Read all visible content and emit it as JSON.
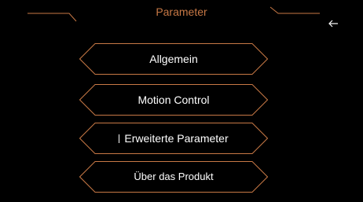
{
  "header": {
    "title": "Parameter",
    "back_icon": "left-arrow-icon",
    "accent_color": "#c77845"
  },
  "menu": {
    "items": [
      {
        "label": "Allgemein"
      },
      {
        "label": "Motion Control"
      },
      {
        "label": "Erweiterte Parameter"
      },
      {
        "label": "Über das Produkt"
      }
    ]
  },
  "colors": {
    "background": "#000000",
    "outline": "#c77845",
    "text": "#ffffff"
  }
}
